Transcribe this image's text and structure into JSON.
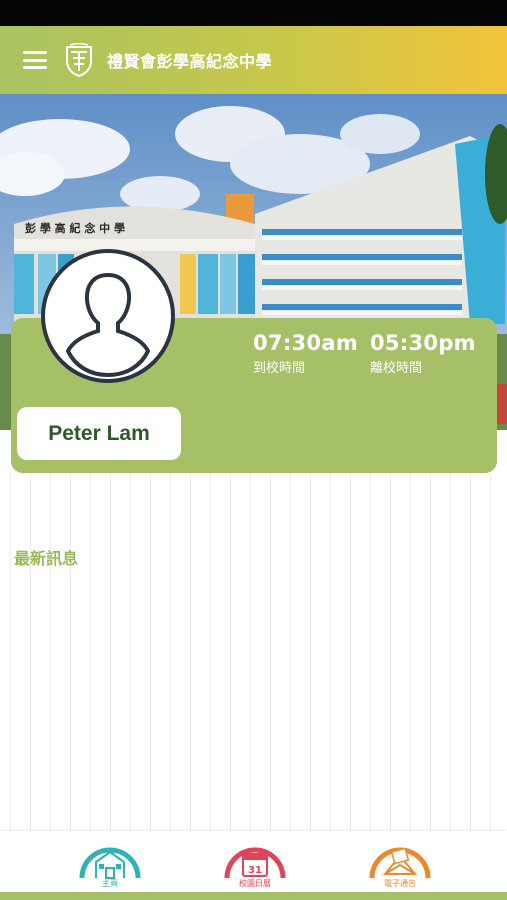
{
  "header": {
    "school_name": "禮賢會彭學高紀念中學",
    "menu_icon": "hamburger-menu-icon",
    "logo_icon": "school-crest-icon"
  },
  "hero": {
    "banner_text": "彭 學 高 紀 念 中 學"
  },
  "profile": {
    "name": "Peter Lam",
    "avatar_icon": "person-silhouette-icon",
    "arrive_time": "07:30am",
    "arrive_label": "到校時間",
    "leave_time": "05:30pm",
    "leave_label": "離校時間"
  },
  "news": {
    "title": "最新訊息"
  },
  "bottom_nav": {
    "items": [
      {
        "label": "主頁",
        "icon": "school-home-icon",
        "color": "#2fb2b3"
      },
      {
        "label": "校園日曆",
        "icon": "calendar-icon",
        "day": "31",
        "color": "#e0445a"
      },
      {
        "label": "電子通告",
        "icon": "envelope-icon",
        "color": "#e98a2f"
      }
    ]
  },
  "colors": {
    "brand_green": "#a5c067",
    "header_yellow": "#f2c33a",
    "name_text": "#2e5a2a"
  }
}
